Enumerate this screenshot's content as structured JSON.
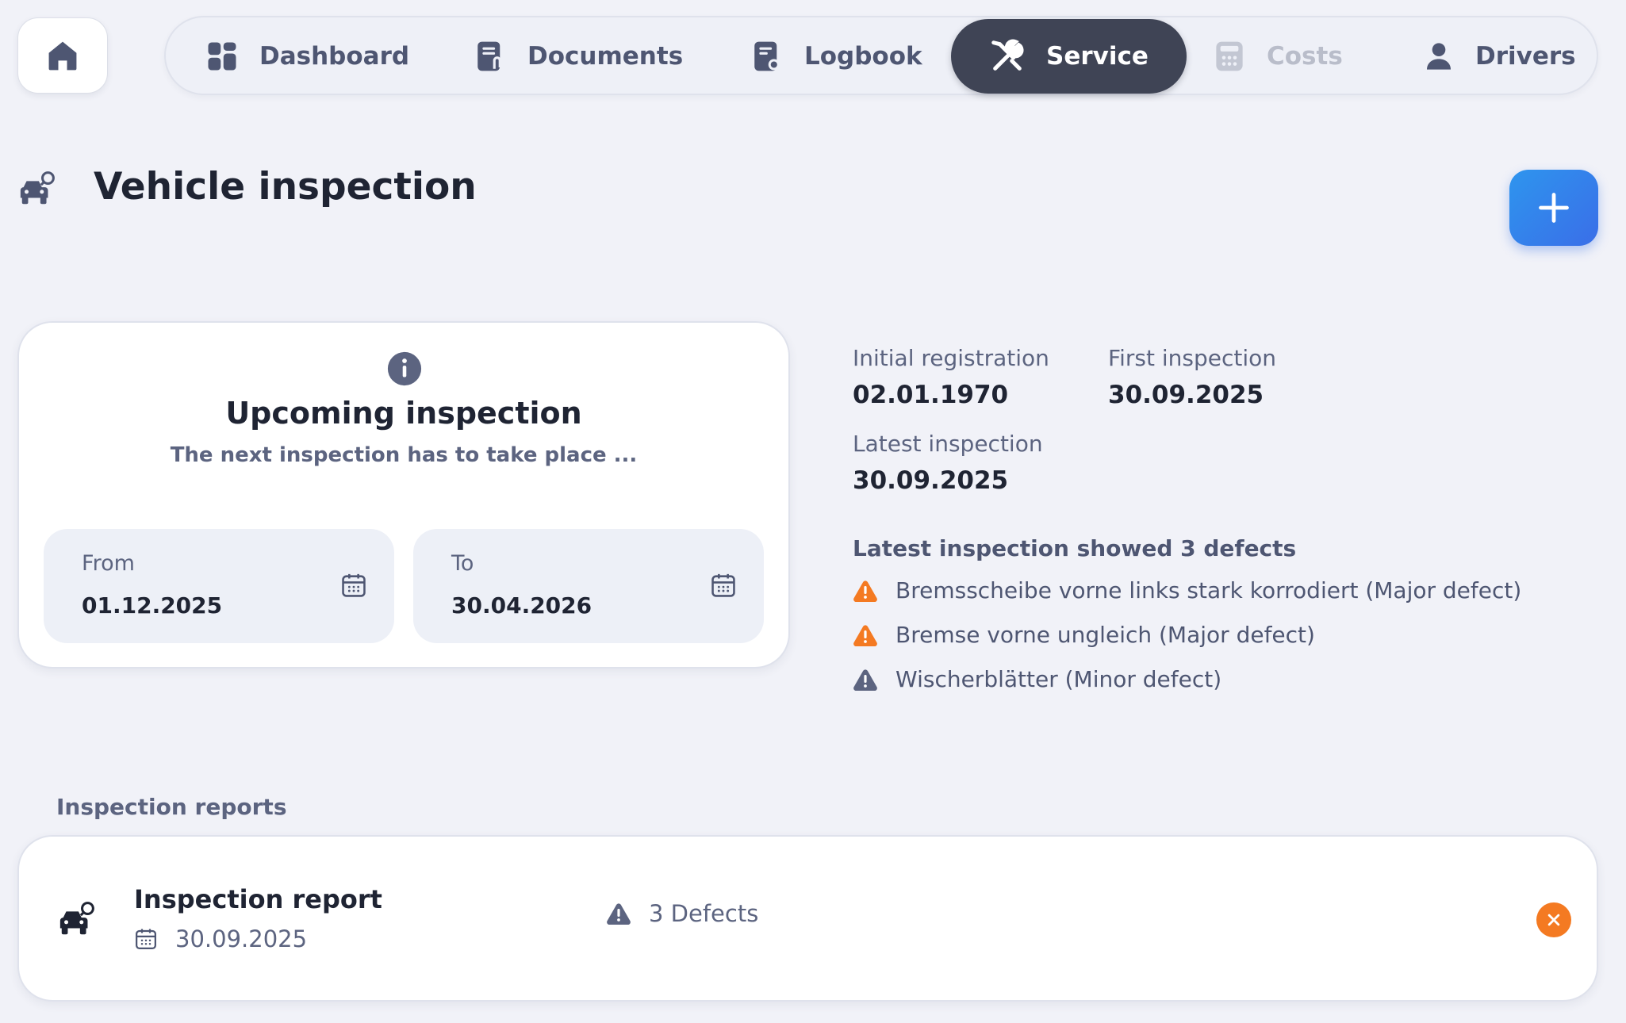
{
  "nav": {
    "items": [
      {
        "label": "Dashboard",
        "icon": "dashboard-icon",
        "state": "normal"
      },
      {
        "label": "Documents",
        "icon": "document-attachment-icon",
        "state": "normal"
      },
      {
        "label": "Logbook",
        "icon": "logbook-icon",
        "state": "normal"
      },
      {
        "label": "Service",
        "icon": "wrench-screwdriver-icon",
        "state": "active"
      },
      {
        "label": "Costs",
        "icon": "calculator-icon",
        "state": "disabled"
      },
      {
        "label": "Drivers",
        "icon": "person-icon",
        "state": "normal"
      }
    ],
    "home_icon": "home-icon"
  },
  "page": {
    "title": "Vehicle inspection",
    "title_icon": "car-inspection-icon",
    "add_icon": "plus-icon"
  },
  "upcoming": {
    "icon": "info-icon",
    "title": "Upcoming inspection",
    "subtitle": "The next inspection has to take place ...",
    "from_label": "From",
    "from_value": "01.12.2025",
    "to_label": "To",
    "to_value": "30.04.2026"
  },
  "details": {
    "initial_registration_label": "Initial registration",
    "initial_registration_value": "02.01.1970",
    "first_inspection_label": "First inspection",
    "first_inspection_value": "30.09.2025",
    "latest_inspection_label": "Latest inspection",
    "latest_inspection_value": "30.09.2025",
    "defects_heading": "Latest inspection showed 3 defects",
    "defects": [
      {
        "text": "Bremsscheibe vorne links stark korrodiert (Major defect)",
        "severity": "major"
      },
      {
        "text": "Bremse vorne ungleich (Major defect)",
        "severity": "major"
      },
      {
        "text": "Wischerblätter (Minor defect)",
        "severity": "minor"
      }
    ]
  },
  "reports": {
    "section_label": "Inspection reports",
    "items": [
      {
        "title": "Inspection report",
        "date": "30.09.2025",
        "defects": "3 Defects"
      }
    ]
  },
  "colors": {
    "background": "#f1f2f8",
    "active_tab": "#3f4455",
    "accent_blue": "#2e95ee",
    "major_defect": "#f47a22",
    "minor_defect": "#5c6480",
    "text_dark": "#1f2433",
    "text_muted": "#5c6480"
  }
}
